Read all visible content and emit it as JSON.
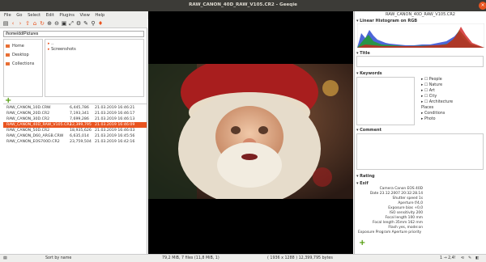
{
  "window": {
    "title": "RAW_CANON_40D_RAW_V105.CR2 - Geeqie"
  },
  "menu": [
    "File",
    "Go",
    "Select",
    "Edit",
    "Plugins",
    "View",
    "Help"
  ],
  "path": {
    "value": "/home/dd/Pictures"
  },
  "bookmarks": [
    {
      "label": "Home"
    },
    {
      "label": "Desktop"
    },
    {
      "label": "Collections"
    }
  ],
  "dirs": [
    {
      "label": ".."
    },
    {
      "label": "Screenshots"
    }
  ],
  "files": [
    {
      "name": "RAW_CANON_10D.CRW",
      "size": "6,445,786",
      "date": "21.03.2019 16:46:21",
      "selected": false
    },
    {
      "name": "RAW_CANON_20D.CR2",
      "size": "7,193,341",
      "date": "21.03.2019 16:46:17",
      "selected": false
    },
    {
      "name": "RAW_CANON_30D.CR2",
      "size": "7,699,286",
      "date": "21.03.2019 16:46:13",
      "selected": false
    },
    {
      "name": "RAW_CANON_40D_RAW_V105.CR2",
      "size": "12,399,795",
      "date": "21.03.2019 16:46:09",
      "selected": true
    },
    {
      "name": "RAW_CANON_50D.CR2",
      "size": "18,935,626",
      "date": "21.03.2019 16:46:03",
      "selected": false
    },
    {
      "name": "RAW_CANON_D60_ARGB.CRW",
      "size": "6,635,014",
      "date": "21.03.2019 16:45:56",
      "selected": false
    },
    {
      "name": "RAW_CANON_EOS700D.CR2",
      "size": "23,759,504",
      "date": "21.03.2019 16:42:16",
      "selected": false
    }
  ],
  "info": {
    "filename": "RAW_CANON_40D_RAW_V105.CR2",
    "histogram_label": "Linear Histogram on RGB",
    "title_label": "Title",
    "keywords_label": "Keywords",
    "keywords": [
      "People",
      "Nature",
      "Art",
      "City",
      "Architecture",
      "Places",
      "Conditions",
      "Photo"
    ],
    "comment_label": "Comment",
    "rating_label": "Rating",
    "exif_label": "Exif",
    "exif": [
      "Camera Canon EOS 40D",
      "Date 23.12.2007 20:32:28.14",
      "Shutter speed 1s",
      "Aperture f/4,0",
      "Exposure bias +0,0",
      "ISO sensitivity 200",
      "Focal length 100 mm",
      "Focal length 35mm 162 mm",
      "Flash yes, mode:on",
      "Exposure Program Aperture priority"
    ]
  },
  "status": {
    "sort": "Sort by name",
    "summary": "79,2 MiB, 7 files (11,8 MiB, 1)",
    "dimensions": "( 1936 x 1288 ) 12,399,795 bytes",
    "zoom": "1 → 2,4!"
  }
}
